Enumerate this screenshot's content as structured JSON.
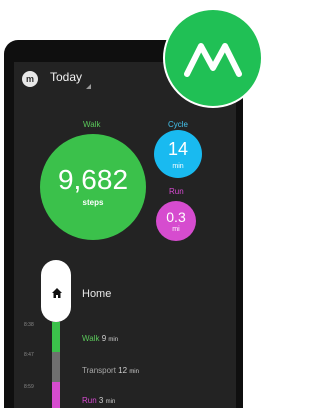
{
  "app": {
    "title": "Today"
  },
  "colors": {
    "walk": "#3bc14b",
    "cycle": "#19baf0",
    "run": "#d64ccf",
    "brand": "#20c055"
  },
  "summary": {
    "walk": {
      "label": "Walk",
      "value": "9,682",
      "unit": "steps"
    },
    "cycle": {
      "label": "Cycle",
      "value": "14",
      "unit": "min"
    },
    "run": {
      "label": "Run",
      "value": "0.3",
      "unit": "mi"
    }
  },
  "timeline": {
    "place": "Home",
    "times": [
      "8:38",
      "8:47",
      "8:59"
    ],
    "activities": [
      {
        "name": "Walk",
        "duration": "9",
        "unit": "min"
      },
      {
        "name": "Transport",
        "duration": "12",
        "unit": "min"
      },
      {
        "name": "Run",
        "duration": "3",
        "unit": "min"
      }
    ]
  }
}
